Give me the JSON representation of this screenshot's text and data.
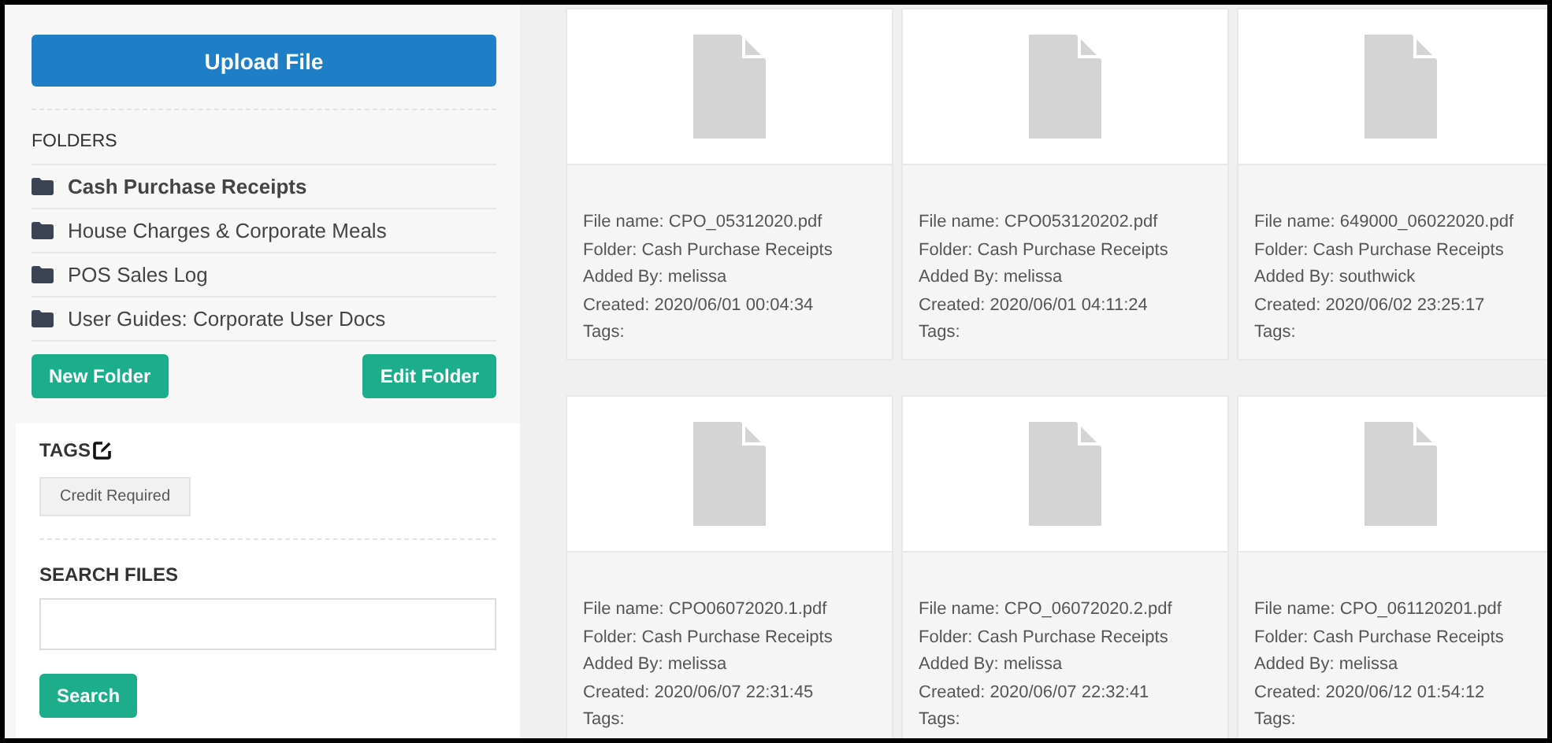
{
  "sidebar": {
    "upload_button": "Upload File",
    "folders_heading": "FOLDERS",
    "folders": [
      {
        "name": "Cash Purchase Receipts",
        "selected": true
      },
      {
        "name": "House Charges & Corporate Meals",
        "selected": false
      },
      {
        "name": "POS Sales Log",
        "selected": false
      },
      {
        "name": "User Guides: Corporate User Docs",
        "selected": false
      }
    ],
    "new_folder_button": "New Folder",
    "edit_folder_button": "Edit Folder",
    "tags_heading": "TAGS",
    "tags": [
      "Credit Required"
    ],
    "search_heading": "SEARCH FILES",
    "search_button": "Search"
  },
  "files": [
    {
      "lines": [
        "File name: CPO_05312020.pdf",
        "Folder: Cash Purchase Receipts",
        "Added By: melissa",
        "Created: 2020/06/01 00:04:34",
        "Tags:"
      ]
    },
    {
      "lines": [
        "File name: CPO053120202.pdf",
        "Folder: Cash Purchase Receipts",
        "Added By: melissa",
        "Created: 2020/06/01 04:11:24",
        "Tags:"
      ]
    },
    {
      "lines": [
        "File name: 649000_06022020.pdf",
        "Folder: Cash Purchase Receipts",
        "Added By: southwick",
        "Created: 2020/06/02 23:25:17",
        "Tags:"
      ]
    },
    {
      "lines": [
        "File name: CPO06072020.1.pdf",
        "Folder: Cash Purchase Receipts",
        "Added By: melissa",
        "Created: 2020/06/07 22:31:45",
        "Tags:"
      ]
    },
    {
      "lines": [
        "File name: CPO_06072020.2.pdf",
        "Folder: Cash Purchase Receipts",
        "Added By: melissa",
        "Created: 2020/06/07 22:32:41",
        "Tags:"
      ]
    },
    {
      "lines": [
        "File name: CPO_061120201.pdf",
        "Folder: Cash Purchase Receipts",
        "Added By: melissa",
        "Created: 2020/06/12 01:54:12",
        "Tags:"
      ]
    }
  ]
}
